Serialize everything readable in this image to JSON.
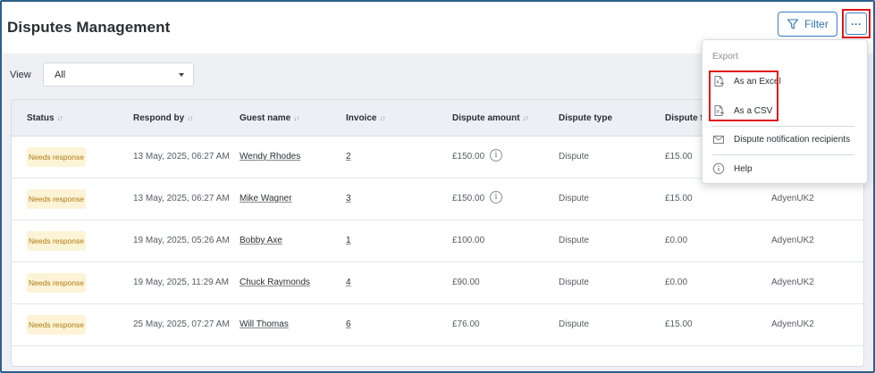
{
  "header": {
    "title": "Disputes Management",
    "filter_label": "Filter",
    "more_label": "···"
  },
  "view": {
    "label": "View",
    "selected": "All"
  },
  "table": {
    "columns": [
      "Status",
      "Respond by",
      "Guest name",
      "Invoice",
      "Dispute amount",
      "Dispute type",
      "Dispute fe"
    ],
    "sort_glyph": "↓↑",
    "rows": [
      {
        "status": "Needs response",
        "respond_by": "13 May, 2025, 06:27 AM",
        "guest": "Wendy Rhodes",
        "invoice": "2",
        "amount": "£150.00",
        "info": "i",
        "type": "Dispute",
        "fee": "£15.00",
        "merchant": ""
      },
      {
        "status": "Needs response",
        "respond_by": "13 May, 2025, 06:27 AM",
        "guest": "Mike Wagner",
        "invoice": "3",
        "amount": "£150.00",
        "info": "i",
        "type": "Dispute",
        "fee": "£15.00",
        "merchant": "AdyenUK2"
      },
      {
        "status": "Needs response",
        "respond_by": "19 May, 2025, 05:26 AM",
        "guest": "Bobby Axe",
        "invoice": "1",
        "amount": "£100.00",
        "type": "Dispute",
        "fee": "£0.00",
        "merchant": "AdyenUK2"
      },
      {
        "status": "Needs response",
        "respond_by": "19 May, 2025, 11:29 AM",
        "guest": "Chuck Raymonds",
        "invoice": "4",
        "amount": "£90.00",
        "type": "Dispute",
        "fee": "£0.00",
        "merchant": "AdyenUK2"
      },
      {
        "status": "Needs response",
        "respond_by": "25 May, 2025, 07:27 AM",
        "guest": "Will Thomas",
        "invoice": "6",
        "amount": "£76.00",
        "type": "Dispute",
        "fee": "£15.00",
        "merchant": "AdyenUK2"
      }
    ]
  },
  "menu": {
    "section_label": "Export",
    "items": [
      {
        "label": "As an Excel",
        "icon": "excel-export-icon"
      },
      {
        "label": "As a CSV",
        "icon": "csv-export-icon"
      },
      {
        "label": "Dispute notification recipients",
        "icon": "mail-icon"
      },
      {
        "label": "Help",
        "icon": "info-icon"
      }
    ]
  },
  "colors": {
    "accent": "#2f74b5",
    "highlight": "#e0141a",
    "badge_bg": "#fdf3d6",
    "badge_text": "#b07a12"
  }
}
